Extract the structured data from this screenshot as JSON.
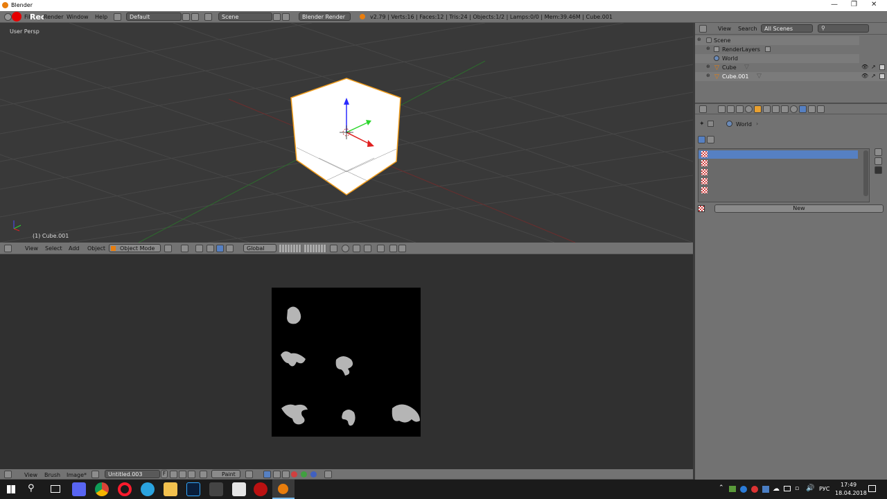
{
  "window": {
    "title": "Blender"
  },
  "info_header": {
    "menus": [
      "File",
      "Render",
      "Window",
      "Help"
    ],
    "rec_label": "Rec",
    "screen_layout": "Default",
    "scene": "Scene",
    "render_engine": "Blender Render",
    "stats": "v2.79 | Verts:16 | Faces:12 | Tris:24 | Objects:1/2 | Lamps:0/0 | Mem:39.46M | Cube.001"
  },
  "viewport": {
    "view_label": "User Persp",
    "object_label": "(1) Cube.001",
    "menus": [
      "View",
      "Select",
      "Add",
      "Object"
    ],
    "mode": "Object Mode",
    "orientation": "Global"
  },
  "image_editor": {
    "menus": [
      "View",
      "Brush",
      "Image*"
    ],
    "image_name": "Untitled.003",
    "image_flag": "F",
    "paint_mode": "Paint"
  },
  "outliner": {
    "menus": [
      "View",
      "Search"
    ],
    "display_mode": "All Scenes",
    "items": [
      {
        "label": "Scene"
      },
      {
        "label": "RenderLayers"
      },
      {
        "label": "World"
      },
      {
        "label": "Cube"
      },
      {
        "label": "Cube.001"
      }
    ]
  },
  "properties": {
    "breadcrumb": "World",
    "new_button": "New"
  },
  "taskbar": {
    "lang": "РУС",
    "time": "17:49",
    "date": "18.04.2018"
  },
  "colors": {
    "accent": "#5680c2",
    "selected_orange": "#f19d1c"
  }
}
